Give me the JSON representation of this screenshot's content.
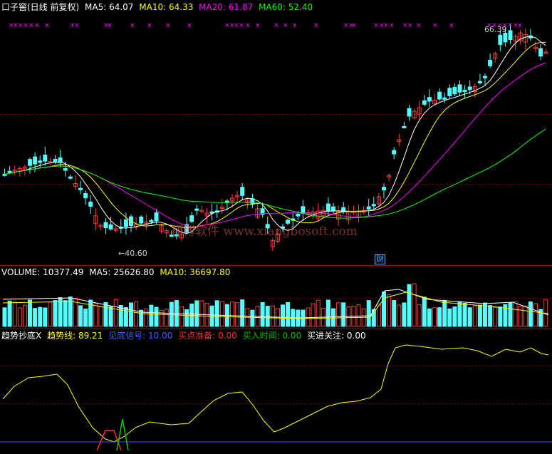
{
  "stock_title": "口子窖(日线 前复权)",
  "price_ma": [
    {
      "label": "MA5:",
      "value": "64.07",
      "color": "#ffffff"
    },
    {
      "label": "MA10:",
      "value": "64.33",
      "color": "#ffff00"
    },
    {
      "label": "MA20:",
      "value": "61.87",
      "color": "#ff00ff"
    },
    {
      "label": "MA60:",
      "value": "52.40",
      "color": "#00ff00"
    }
  ],
  "high_marker": "66.39",
  "low_marker": "40.60",
  "finance_flag": "财",
  "watermark": "翔博软件 www.xiangbosoft.com",
  "volume": [
    {
      "label": "VOLUME:",
      "value": "10377.49",
      "color": "#ffffff"
    },
    {
      "label": "MA5:",
      "value": "25626.80",
      "color": "#ffffff"
    },
    {
      "label": "MA10:",
      "value": "36697.80",
      "color": "#ffff00"
    }
  ],
  "indicator_name": "趋势抄底X",
  "indicator": [
    {
      "label": "趋势线:",
      "value": "89.21",
      "color": "#ffff00"
    },
    {
      "label": "见底信号:",
      "value": "10.00",
      "color": "#4060ff"
    },
    {
      "label": "买点准备:",
      "value": "0.00",
      "color": "#ff3030"
    },
    {
      "label": "买入时间:",
      "value": "0.00",
      "color": "#00c000"
    },
    {
      "label": "买进关注:",
      "value": "0.00",
      "color": "#ffffff"
    }
  ],
  "colors": {
    "up": "#ff3c3c",
    "down": "#54ffff",
    "ma5": "#ffffff",
    "ma10": "#ffff00",
    "ma20": "#ff00ff",
    "ma60": "#00ff00",
    "signal": "#ff00ff"
  }
}
